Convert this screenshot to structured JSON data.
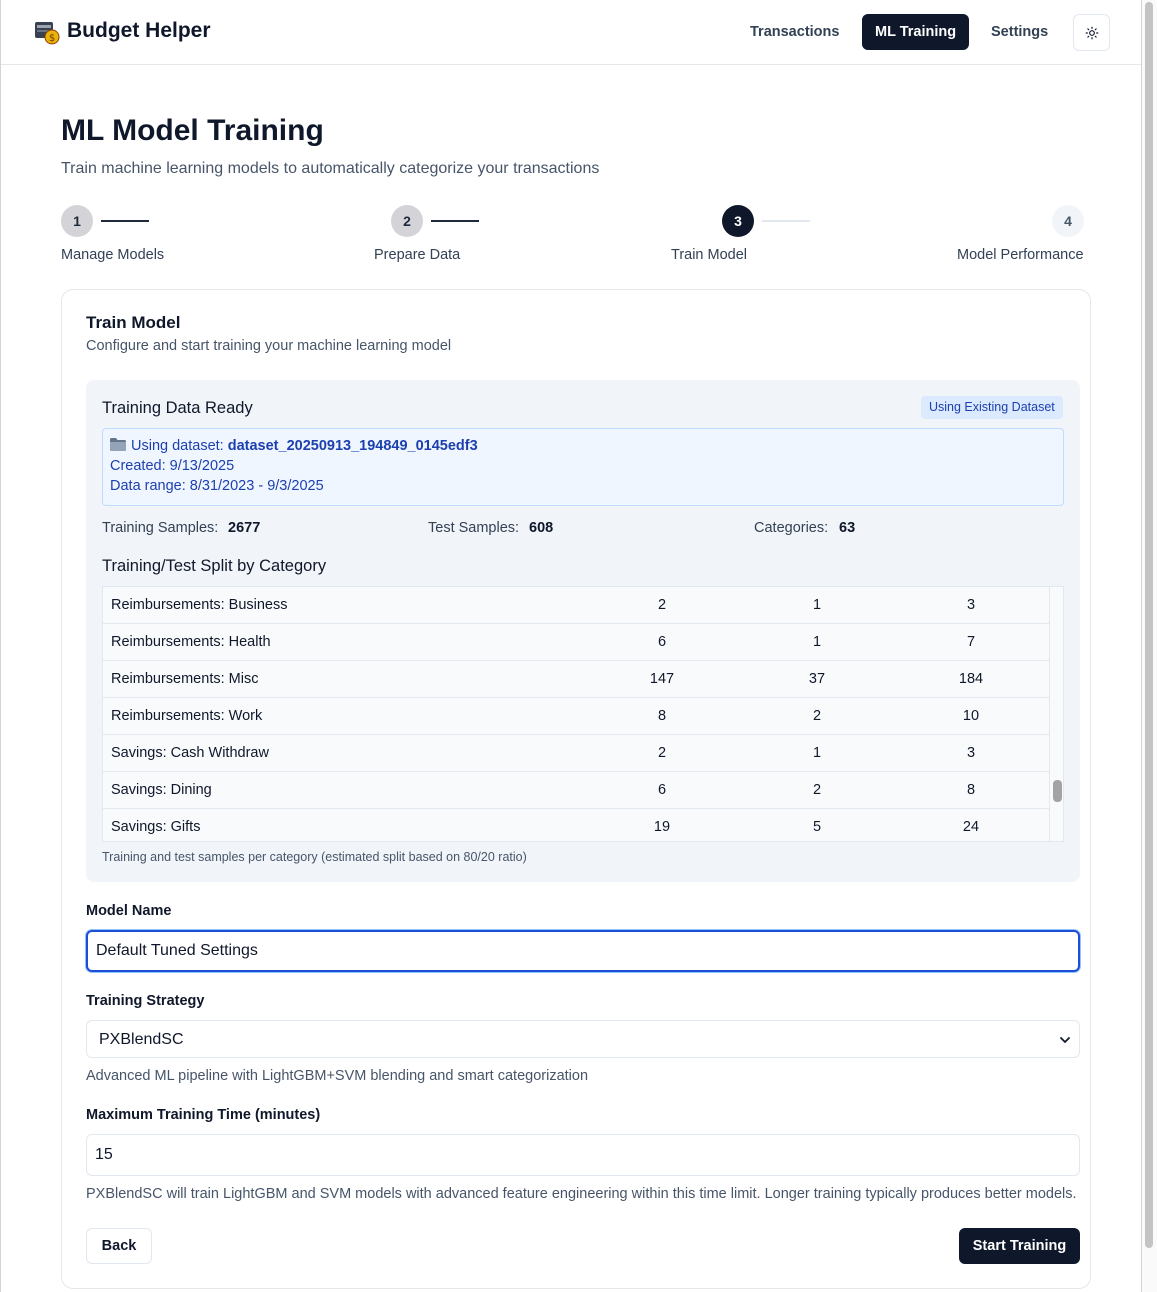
{
  "header": {
    "brand": "Budget Helper",
    "nav": [
      {
        "label": "Transactions",
        "active": false
      },
      {
        "label": "ML Training",
        "active": true
      },
      {
        "label": "Settings",
        "active": false
      }
    ],
    "theme_icon": "sun-icon"
  },
  "page": {
    "title": "ML Model Training",
    "subtitle": "Train machine learning models to automatically categorize your transactions"
  },
  "stepper": [
    {
      "number": "1",
      "label": "Manage Models",
      "state": "done"
    },
    {
      "number": "2",
      "label": "Prepare Data",
      "state": "done"
    },
    {
      "number": "3",
      "label": "Train Model",
      "state": "current"
    },
    {
      "number": "4",
      "label": "Model Performance",
      "state": "todo"
    }
  ],
  "card": {
    "title": "Train Model",
    "description": "Configure and start training your machine learning model"
  },
  "dataset": {
    "panel_title": "Training Data Ready",
    "badge": "Using Existing Dataset",
    "using_prefix": "Using dataset:",
    "name": "dataset_20250913_194849_0145edf3",
    "created": "Created: 9/13/2025",
    "range": "Data range: 8/31/2023 - 9/3/2025",
    "folder_icon": "folder-icon"
  },
  "stats": {
    "training_label": "Training Samples:",
    "training_value": "2677",
    "test_label": "Test Samples:",
    "test_value": "608",
    "categories_label": "Categories:",
    "categories_value": "63"
  },
  "split": {
    "title": "Training/Test Split by Category",
    "rows": [
      {
        "category": "Reimbursements: Business",
        "train": "2",
        "test": "1",
        "total": "3"
      },
      {
        "category": "Reimbursements: Health",
        "train": "6",
        "test": "1",
        "total": "7"
      },
      {
        "category": "Reimbursements: Misc",
        "train": "147",
        "test": "37",
        "total": "184"
      },
      {
        "category": "Reimbursements: Work",
        "train": "8",
        "test": "2",
        "total": "10"
      },
      {
        "category": "Savings: Cash Withdraw",
        "train": "2",
        "test": "1",
        "total": "3"
      },
      {
        "category": "Savings: Dining",
        "train": "6",
        "test": "2",
        "total": "8"
      },
      {
        "category": "Savings: Gifts",
        "train": "19",
        "test": "5",
        "total": "24"
      }
    ],
    "note": "Training and test samples per category (estimated split based on 80/20 ratio)"
  },
  "form": {
    "model_name_label": "Model Name",
    "model_name_value": "Default Tuned Settings",
    "strategy_label": "Training Strategy",
    "strategy_value": "PXBlendSC",
    "strategy_help": "Advanced ML pipeline with LightGBM+SVM blending and smart categorization",
    "max_time_label": "Maximum Training Time (minutes)",
    "max_time_value": "15",
    "max_time_help": "PXBlendSC will train LightGBM and SVM models with advanced feature engineering within this time limit. Longer training typically produces better models."
  },
  "actions": {
    "back": "Back",
    "start": "Start Training"
  }
}
